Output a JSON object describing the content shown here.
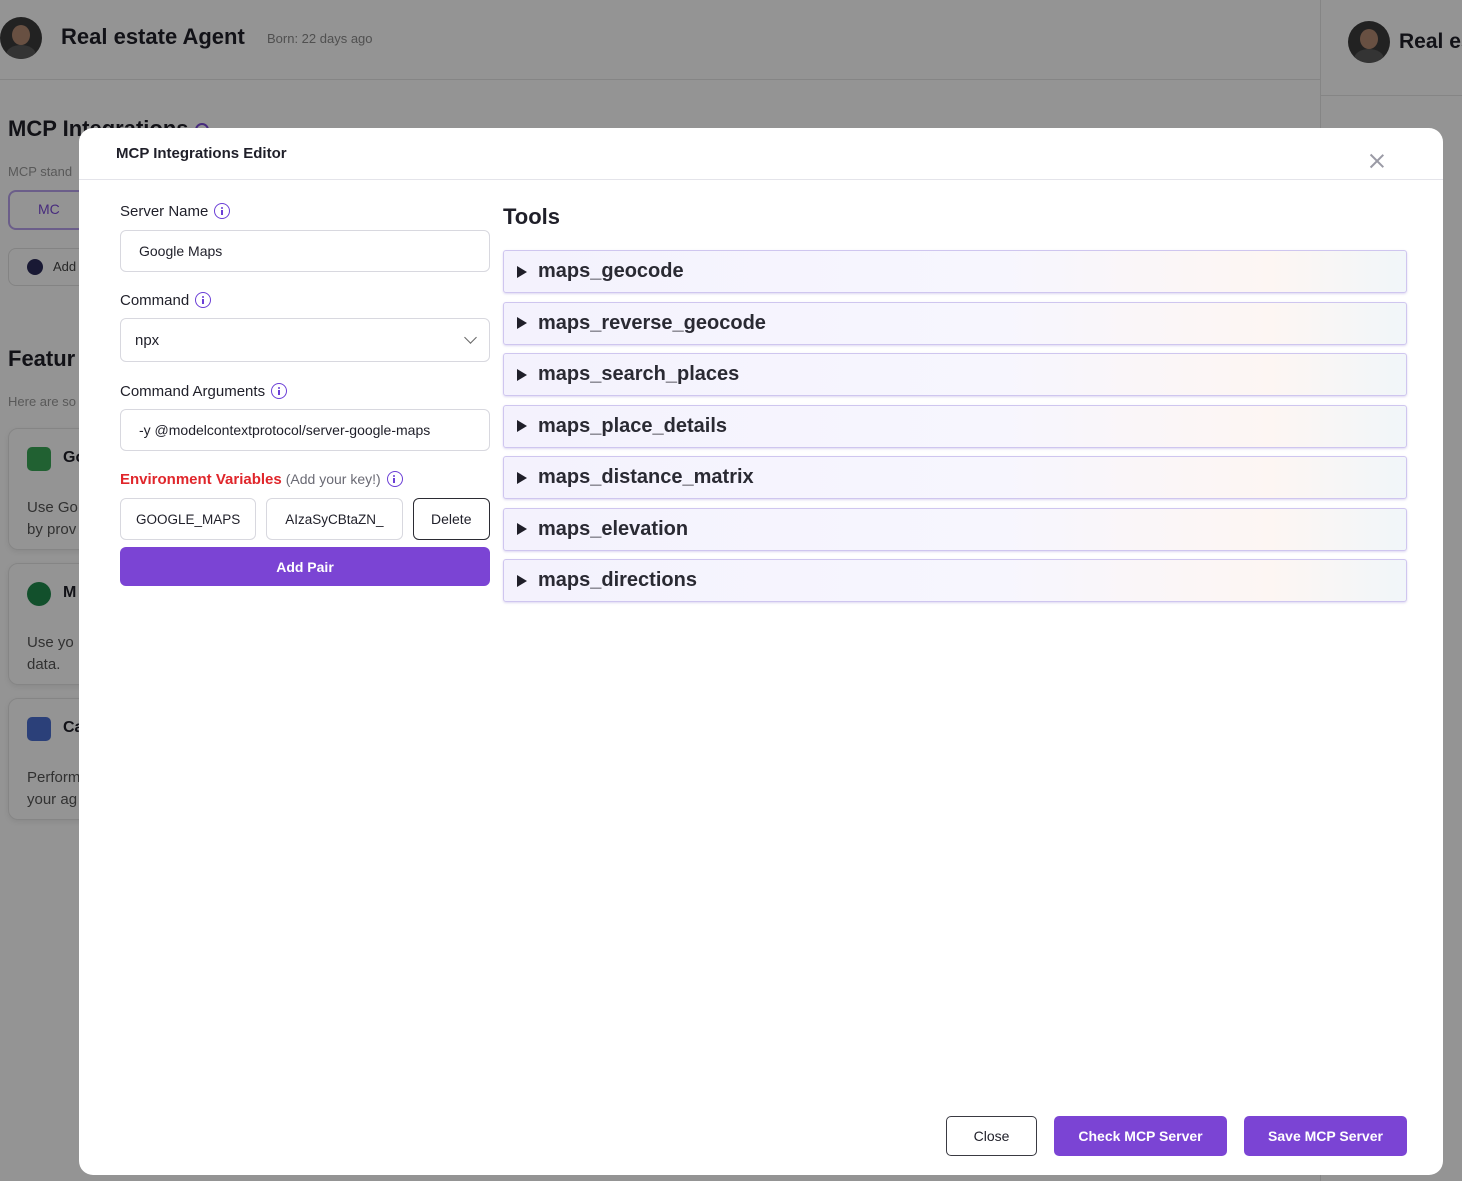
{
  "background": {
    "agent_name": "Real estate Agent",
    "born": "Born: 22 days ago",
    "right_panel_title": "Real es",
    "section_title": "MCP Integrations",
    "section_sub": "MCP stand",
    "search_fragment": "MC",
    "add_fragment": "Add",
    "features_title": "Featur",
    "features_sub": "Here are so",
    "cards": [
      {
        "head": "Go",
        "line1": "Use Go",
        "line2": "by prov"
      },
      {
        "head": "M",
        "line1": "Use yo",
        "line2": "data."
      },
      {
        "head": "Ca",
        "line1": "Perform",
        "line2": "your ag"
      }
    ]
  },
  "modal": {
    "title": "MCP Integrations Editor",
    "server_name": {
      "label": "Server Name",
      "value": "Google Maps"
    },
    "command": {
      "label": "Command",
      "value": "npx"
    },
    "command_args": {
      "label": "Command Arguments",
      "value": "-y @modelcontextprotocol/server-google-maps"
    },
    "env": {
      "label": "Environment Variables",
      "hint": "(Add your key!)",
      "key": "GOOGLE_MAPS",
      "value": "AIzaSyCBtaZN_",
      "delete_label": "Delete",
      "add_label": "Add Pair"
    },
    "tools": {
      "title": "Tools",
      "items": [
        "maps_geocode",
        "maps_reverse_geocode",
        "maps_search_places",
        "maps_place_details",
        "maps_distance_matrix",
        "maps_elevation",
        "maps_directions"
      ]
    },
    "footer": {
      "close_label": "Close",
      "check_label": "Check MCP Server",
      "save_label": "Save MCP Server"
    }
  },
  "colors": {
    "accent": "#7b44d4",
    "env_label": "#e0262b",
    "overlay": "rgba(0,0,0,0.42)"
  }
}
